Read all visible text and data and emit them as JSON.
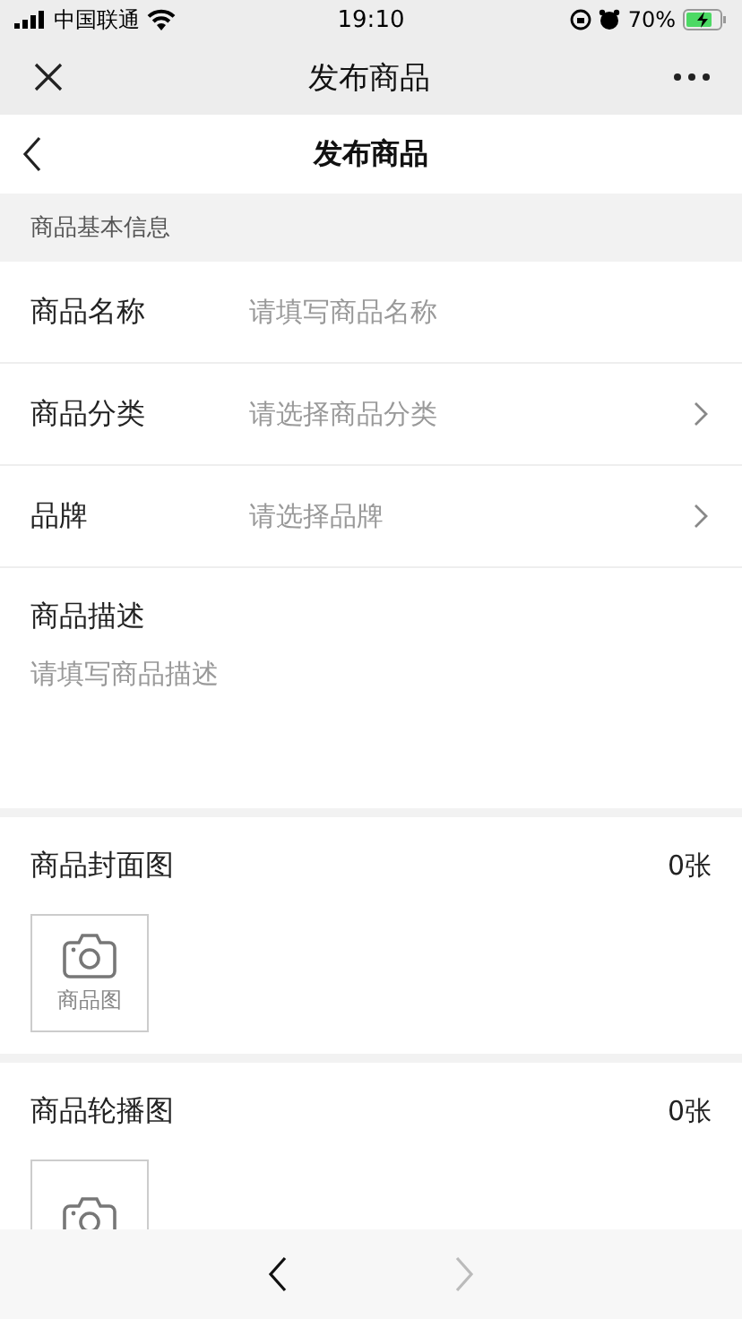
{
  "status_bar": {
    "carrier": "中国联通",
    "time": "19:10",
    "battery": "70%"
  },
  "nav_bar": {
    "title": "发布商品"
  },
  "page_header": {
    "title": "发布商品"
  },
  "section": {
    "title": "商品基本信息"
  },
  "fields": [
    {
      "kind": "input",
      "label": "商品名称",
      "placeholder": "请填写商品名称"
    },
    {
      "kind": "select",
      "label": "商品分类",
      "placeholder": "请选择商品分类"
    },
    {
      "kind": "select",
      "label": "品牌",
      "placeholder": "请选择品牌"
    }
  ],
  "description": {
    "label": "商品描述",
    "placeholder": "请填写商品描述"
  },
  "image_groups": [
    {
      "label": "商品封面图",
      "count": "0张",
      "tile_label": "商品图"
    },
    {
      "label": "商品轮播图",
      "count": "0张"
    }
  ],
  "toolbar": {
    "back_disabled": false,
    "forward_disabled": true
  }
}
